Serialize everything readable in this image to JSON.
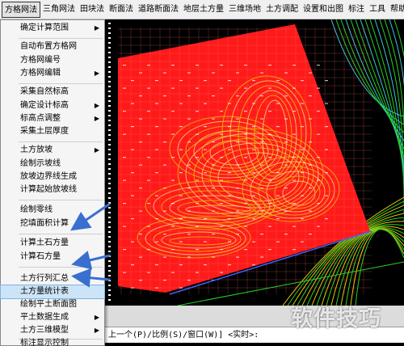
{
  "menubar": {
    "items": [
      "方格网法",
      "三角网法",
      "田块法",
      "断面法",
      "道路断面法",
      "地层土方量",
      "三维场地",
      "土方调配",
      "设置和出图",
      "标注",
      "工具",
      "帮助"
    ]
  },
  "dropdown": {
    "items": [
      {
        "label": "确定计算范围",
        "submenu": true
      },
      {
        "label": "自动布置方格网",
        "submenu": false
      },
      {
        "label": "方格网编号",
        "submenu": false
      },
      {
        "label": "方格网编辑",
        "submenu": true
      },
      {
        "label": "采集自然标高",
        "submenu": false
      },
      {
        "label": "确定设计标高",
        "submenu": true
      },
      {
        "label": "标高点调整",
        "submenu": true
      },
      {
        "label": "采集土层厚度",
        "submenu": false
      },
      {
        "label": "土方放坡",
        "submenu": true
      },
      {
        "label": "绘制示坡线",
        "submenu": false
      },
      {
        "label": "放坡边界线生成",
        "submenu": false
      },
      {
        "label": "计算起始放坡线",
        "submenu": false
      },
      {
        "label": "绘制零线",
        "submenu": false
      },
      {
        "label": "挖填面积计算",
        "submenu": false
      },
      {
        "label": "计算土石方量",
        "submenu": false
      },
      {
        "label": "计算石方量",
        "submenu": false
      },
      {
        "label": "土方行列汇总",
        "submenu": false
      },
      {
        "label": "土方量统计表",
        "submenu": false
      },
      {
        "label": "绘制平土断面图",
        "submenu": false
      },
      {
        "label": "平土数据生成",
        "submenu": true
      },
      {
        "label": "土方三维模型",
        "submenu": true
      },
      {
        "label": "标注显示控制",
        "submenu": false
      }
    ],
    "submenu_arrow": "▶"
  },
  "command_line": {
    "text": "上一个(P)/比例(S)/窗口(W)] <实时>:"
  },
  "watermark": {
    "text": "软件技巧"
  },
  "colors": {
    "grid_red": "#ff1a1a",
    "contour_yellow": "#e6c800",
    "contour_green": "#28d228",
    "arrow_blue": "#3a6fd0"
  }
}
